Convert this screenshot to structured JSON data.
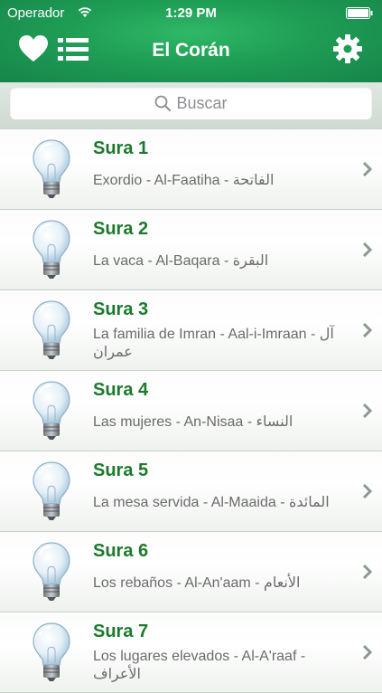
{
  "status": {
    "carrier": "Operador",
    "time": "1:29 PM"
  },
  "nav": {
    "title": "El Corán"
  },
  "search": {
    "placeholder": "Buscar"
  },
  "suras": [
    {
      "title": "Sura 1",
      "subtitle": "Exordio - Al-Faatiha - الفاتحة"
    },
    {
      "title": "Sura 2",
      "subtitle": "La vaca - Al-Baqara - البقرة"
    },
    {
      "title": "Sura 3",
      "subtitle": "La familia de Imran - Aal-i-Imraan - آل عمران"
    },
    {
      "title": "Sura 4",
      "subtitle": "Las mujeres - An-Nisaa - النساء"
    },
    {
      "title": "Sura 5",
      "subtitle": "La mesa servida - Al-Maaida - المائدة"
    },
    {
      "title": "Sura 6",
      "subtitle": "Los rebaños - Al-An'aam - الأنعام"
    },
    {
      "title": "Sura 7",
      "subtitle": "Los lugares elevados - Al-A'raaf - الأعراف"
    }
  ],
  "colors": {
    "header": "#1f9d55",
    "sura_title": "#1c7a2c"
  },
  "icons": {
    "favorites": "heart-icon",
    "index": "list-icon",
    "settings": "gear-icon",
    "row": "lightbulb-icon",
    "disclosure": "chevron-right-icon"
  }
}
